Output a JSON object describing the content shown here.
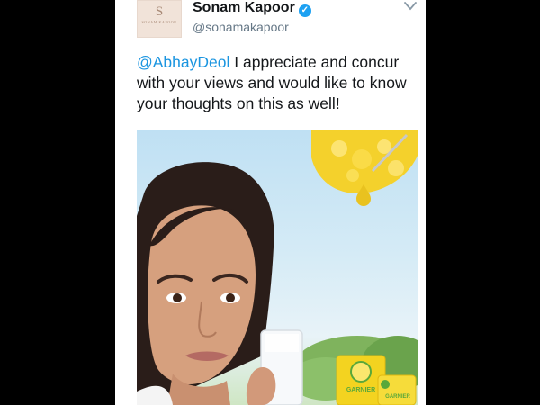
{
  "tweet": {
    "author": {
      "name": "Sonam Kapoor",
      "handle": "@sonamakapoor",
      "verified": true,
      "avatar_monogram": "S",
      "avatar_wordmark": "SONAM KAPOOR"
    },
    "text": {
      "mention": "@AbhayDeol",
      "body": " I appreciate and concur with your views and would like to know your thoughts on this as well!"
    },
    "media": {
      "product_brand": "GARNIER",
      "subject": "advertisement"
    }
  },
  "icons": {
    "verified": "verified-badge-icon",
    "menu": "chevron-down-icon"
  },
  "colors": {
    "link": "#1b95e0",
    "verified": "#1da1f2",
    "handle": "#657786",
    "name": "#14171a",
    "product_yellow": "#f3d320",
    "product_green": "#5aa83a"
  }
}
